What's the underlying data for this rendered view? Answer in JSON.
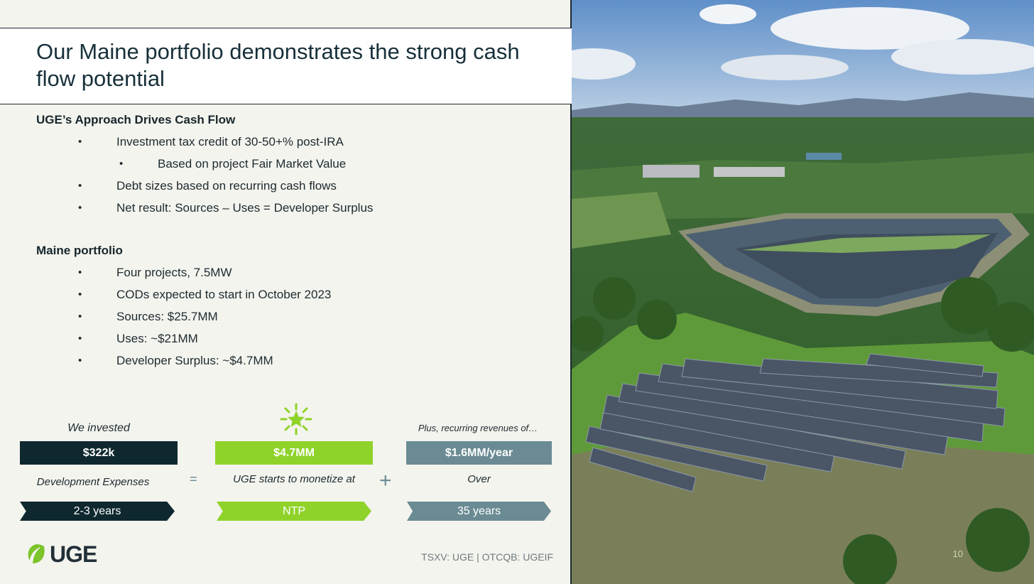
{
  "title": "Our Maine portfolio demonstrates the strong cash flow potential",
  "approach": {
    "heading": "UGE’s Approach Drives Cash Flow",
    "items": [
      {
        "text": "Investment tax credit of 30-50+% post-IRA",
        "level": 1
      },
      {
        "text": "Based on project Fair Market Value",
        "level": 2
      },
      {
        "text": "Debt sizes based on recurring cash flows",
        "level": 1
      },
      {
        "text": "Net result: Sources – Uses = Developer Surplus",
        "level": 1
      }
    ]
  },
  "portfolio": {
    "heading": "Maine portfolio",
    "items": [
      "Four projects, 7.5MW",
      "CODs expected to start in October 2023",
      "Sources: $25.7MM",
      "Uses: ~$21MM",
      "Developer Surplus: ~$4.7MM"
    ]
  },
  "equation": {
    "col1": {
      "top": "We invested",
      "box": "$322k",
      "middle": "Development Expenses",
      "arrow": "2-3 years",
      "color": "#0f2830"
    },
    "equals": "=",
    "col2": {
      "box": "$4.7MM",
      "middle": "UGE starts to monetize at",
      "arrow": "NTP",
      "color": "#8fd32a"
    },
    "plus": "+",
    "col3": {
      "top": "Plus, recurring revenues of…",
      "box": "$1.6MM/year",
      "middle": "Over",
      "arrow": "35 years",
      "color": "#6a8b93"
    }
  },
  "logo": {
    "text": "UGE",
    "icon": "leaf-icon"
  },
  "ticker": "TSXV: UGE | OTCQB: UGEIF",
  "page_number": "10",
  "icons": {
    "sparkle": "sparkle-icon"
  }
}
